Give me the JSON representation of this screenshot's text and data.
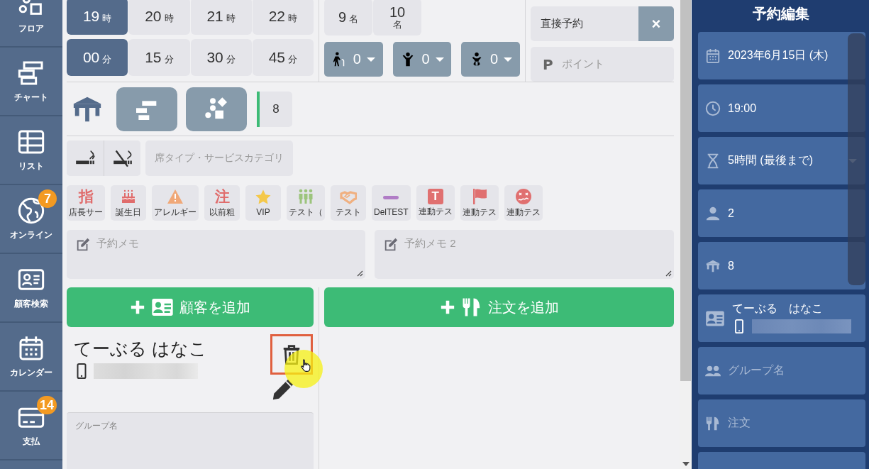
{
  "sidebar": {
    "items": [
      {
        "kind": "floor",
        "label": "フロア"
      },
      {
        "kind": "chart",
        "label": "チャート"
      },
      {
        "kind": "list",
        "label": "リスト"
      },
      {
        "kind": "globe",
        "label": "オンライン",
        "badge": "7"
      },
      {
        "kind": "customer",
        "label": "顧客検索"
      },
      {
        "kind": "calendar",
        "label": "カレンダー"
      },
      {
        "kind": "payment",
        "label": "支払",
        "badge": "14"
      }
    ]
  },
  "time_picker": {
    "hours": [
      {
        "value": "19",
        "unit": "時",
        "selected": true
      },
      {
        "value": "20",
        "unit": "時",
        "selected": false
      },
      {
        "value": "21",
        "unit": "時",
        "selected": false
      },
      {
        "value": "22",
        "unit": "時",
        "selected": false
      }
    ],
    "minutes": [
      {
        "value": "00",
        "unit": "分",
        "selected": true
      },
      {
        "value": "15",
        "unit": "分",
        "selected": false
      },
      {
        "value": "30",
        "unit": "分",
        "selected": false
      },
      {
        "value": "45",
        "unit": "分",
        "selected": false
      }
    ]
  },
  "party_size": {
    "options": [
      {
        "value": "9",
        "unit": "名",
        "stacked": false
      },
      {
        "value": "10",
        "unit": "名",
        "stacked": true
      }
    ],
    "guest_types": [
      {
        "kind": "elder",
        "value": "0"
      },
      {
        "kind": "child",
        "value": "0"
      },
      {
        "kind": "infant",
        "value": "0"
      }
    ]
  },
  "source": {
    "value": "直接予約",
    "clear": "×"
  },
  "points": {
    "prefix": "P",
    "placeholder": "ポイント"
  },
  "seating": {
    "views": [
      {
        "kind": "table",
        "selected": true
      },
      {
        "kind": "chart",
        "selected": false
      },
      {
        "kind": "layout",
        "selected": false
      }
    ],
    "table_number": "8"
  },
  "smoking": [
    {
      "kind": "smoking"
    },
    {
      "kind": "non_smoking"
    }
  ],
  "seat_type": {
    "placeholder": "席タイプ・サービスカテゴリ"
  },
  "tags": [
    {
      "kind": "glyph",
      "icon_text": "指",
      "label": "店長サー",
      "color": "#e06c6c"
    },
    {
      "kind": "cake",
      "label": "誕生日",
      "color": "#e06c6c"
    },
    {
      "kind": "warning",
      "label": "アレルギー",
      "color": "#f0a878"
    },
    {
      "kind": "glyph",
      "icon_text": "注",
      "label": "以前粗",
      "color": "#e06c6c"
    },
    {
      "kind": "star",
      "label": "VIP",
      "color": "#f4c84a"
    },
    {
      "kind": "people",
      "label": "テスト（",
      "color": "#9cc47c"
    },
    {
      "kind": "handshake",
      "label": "テスト",
      "color": "#f0b080"
    },
    {
      "kind": "minus",
      "label": "DelTEST",
      "color": "#b07cc6"
    },
    {
      "kind": "glyph_box",
      "icon_text": "T",
      "label": "連動テス",
      "color": "#e07070"
    },
    {
      "kind": "flag",
      "label": "連動テス",
      "color": "#e07070"
    },
    {
      "kind": "dizzy",
      "label": "連動テス",
      "color": "#e07070"
    }
  ],
  "memos": [
    {
      "placeholder": "予約メモ"
    },
    {
      "placeholder": "予約メモ 2"
    }
  ],
  "actions": [
    {
      "kind": "customer",
      "label": "顧客を追加"
    },
    {
      "kind": "order",
      "label": "注文を追加"
    }
  ],
  "customer": {
    "name": "てーぶる はなこ",
    "group_placeholder": "グループ名"
  },
  "panel": {
    "title": "予約編集",
    "fields": [
      {
        "kind": "date",
        "value": "2023年6月15日 (木)"
      },
      {
        "kind": "time",
        "value": "19:00"
      },
      {
        "kind": "duration",
        "value": "5時間 (最後まで)"
      },
      {
        "kind": "guests",
        "value": "2"
      },
      {
        "kind": "table",
        "value": "8"
      },
      {
        "kind": "customer",
        "value": "てーぶる　はなこ"
      },
      {
        "kind": "group",
        "placeholder": "グループ名"
      },
      {
        "kind": "order",
        "placeholder": "注文"
      },
      {
        "kind": "comment"
      }
    ]
  }
}
